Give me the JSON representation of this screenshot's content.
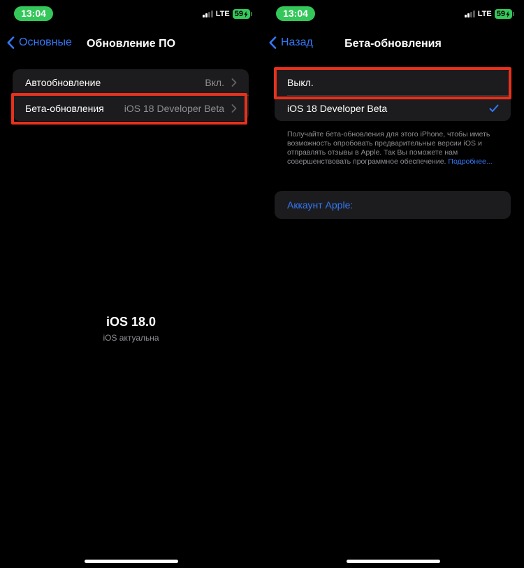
{
  "status_bar": {
    "time": "13:04",
    "network": "LTE",
    "battery": "59"
  },
  "left": {
    "nav": {
      "back_label": "Основные",
      "title": "Обновление ПО"
    },
    "settings": [
      {
        "label": "Автообновление",
        "value": "Вкл."
      },
      {
        "label": "Бета-обновления",
        "value": "iOS 18 Developer Beta"
      }
    ],
    "version_title": "iOS 18.0",
    "version_status": "iOS актуальна"
  },
  "right": {
    "nav": {
      "back_label": "Назад",
      "title": "Бета-обновления"
    },
    "options": [
      {
        "label": "Выкл.",
        "selected": false
      },
      {
        "label": "iOS 18 Developer Beta",
        "selected": true
      }
    ],
    "footnote": "Получайте бета-обновления для этого iPhone, чтобы иметь возможность опробовать предварительные версии iOS и отправлять отзывы в Apple. Так Вы поможете нам совершенствовать программное обеспечение.",
    "footnote_link": "Подробнее...",
    "account_label": "Аккаунт Apple:"
  },
  "colors": {
    "accent": "#3478f6",
    "highlight": "#e5311d",
    "status_green": "#34c759",
    "cell": "#1c1c1e"
  }
}
